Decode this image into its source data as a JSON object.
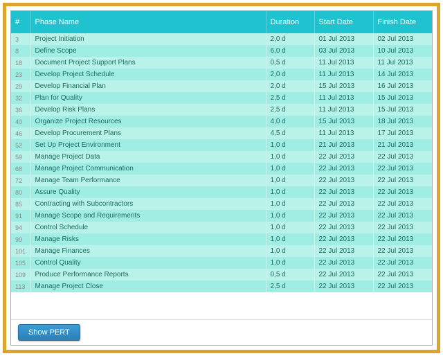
{
  "headers": {
    "num": "#",
    "name": "Phase Name",
    "duration": "Duration",
    "start": "Start Date",
    "finish": "Finish Date"
  },
  "rows": [
    {
      "num": "3",
      "name": "Project Initiation",
      "dur": "2,0 d",
      "start": "01 Jul 2013",
      "finish": "02 Jul 2013"
    },
    {
      "num": "8",
      "name": "Define Scope",
      "dur": "6,0 d",
      "start": "03 Jul 2013",
      "finish": "10 Jul 2013"
    },
    {
      "num": "18",
      "name": "Document Project Support Plans",
      "dur": "0,5 d",
      "start": "11 Jul 2013",
      "finish": "11 Jul 2013"
    },
    {
      "num": "23",
      "name": "Develop Project Schedule",
      "dur": "2,0 d",
      "start": "11 Jul 2013",
      "finish": "14 Jul 2013"
    },
    {
      "num": "29",
      "name": "Develop Financial Plan",
      "dur": "2,0 d",
      "start": "15 Jul 2013",
      "finish": "16 Jul 2013"
    },
    {
      "num": "32",
      "name": "Plan for Quality",
      "dur": "2,5 d",
      "start": "11 Jul 2013",
      "finish": "15 Jul 2013"
    },
    {
      "num": "36",
      "name": "Develop Risk Plans",
      "dur": "2,5 d",
      "start": "11 Jul 2013",
      "finish": "15 Jul 2013"
    },
    {
      "num": "40",
      "name": "Organize Project Resources",
      "dur": "4,0 d",
      "start": "15 Jul 2013",
      "finish": "18 Jul 2013"
    },
    {
      "num": "46",
      "name": "Develop Procurement Plans",
      "dur": "4,5 d",
      "start": "11 Jul 2013",
      "finish": "17 Jul 2013"
    },
    {
      "num": "52",
      "name": "Set Up Project Environment",
      "dur": "1,0 d",
      "start": "21 Jul 2013",
      "finish": "21 Jul 2013"
    },
    {
      "num": "59",
      "name": "Manage Project Data",
      "dur": "1,0 d",
      "start": "22 Jul 2013",
      "finish": "22 Jul 2013"
    },
    {
      "num": "68",
      "name": "Manage Project Communication",
      "dur": "1,0 d",
      "start": "22 Jul 2013",
      "finish": "22 Jul 2013"
    },
    {
      "num": "72",
      "name": "Manage Team Performance",
      "dur": "1,0 d",
      "start": "22 Jul 2013",
      "finish": "22 Jul 2013"
    },
    {
      "num": "80",
      "name": "Assure Quality",
      "dur": "1,0 d",
      "start": "22 Jul 2013",
      "finish": "22 Jul 2013"
    },
    {
      "num": "85",
      "name": "Contracting with Subcontractors",
      "dur": "1,0 d",
      "start": "22 Jul 2013",
      "finish": "22 Jul 2013"
    },
    {
      "num": "91",
      "name": "Manage Scope and Requirements",
      "dur": "1,0 d",
      "start": "22 Jul 2013",
      "finish": "22 Jul 2013"
    },
    {
      "num": "94",
      "name": "Control Schedule",
      "dur": "1,0 d",
      "start": "22 Jul 2013",
      "finish": "22 Jul 2013"
    },
    {
      "num": "99",
      "name": "Manage Risks",
      "dur": "1,0 d",
      "start": "22 Jul 2013",
      "finish": "22 Jul 2013"
    },
    {
      "num": "101",
      "name": "Manage Finances",
      "dur": "1,0 d",
      "start": "22 Jul 2013",
      "finish": "22 Jul 2013"
    },
    {
      "num": "105",
      "name": "Control Quality",
      "dur": "1,0 d",
      "start": "22 Jul 2013",
      "finish": "22 Jul 2013"
    },
    {
      "num": "109",
      "name": "Produce Performance Reports",
      "dur": "0,5 d",
      "start": "22 Jul 2013",
      "finish": "22 Jul 2013"
    },
    {
      "num": "113",
      "name": "Manage Project Close",
      "dur": "2,5 d",
      "start": "22 Jul 2013",
      "finish": "22 Jul 2013"
    }
  ],
  "button": {
    "show_pert": "Show PERT"
  }
}
